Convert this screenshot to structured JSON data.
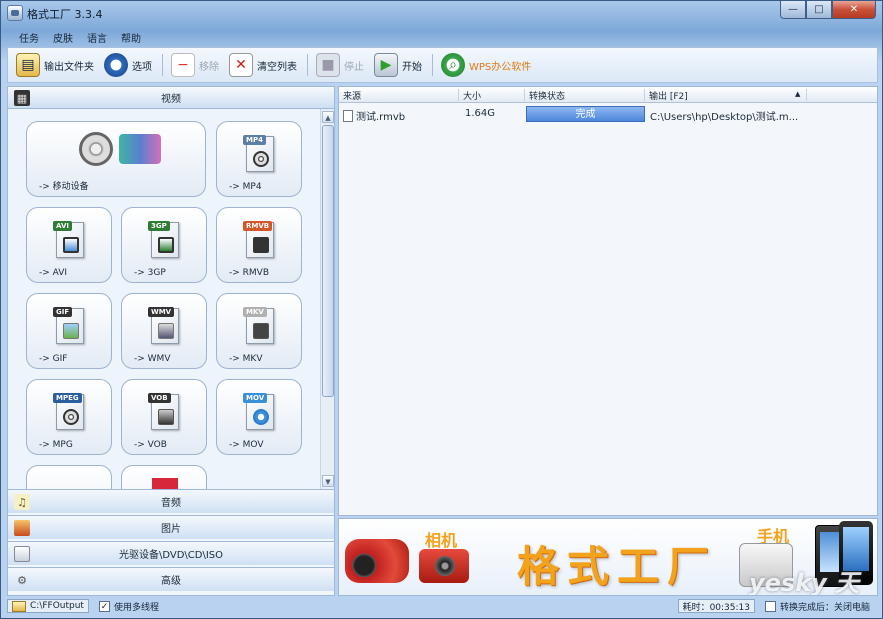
{
  "window": {
    "title": "格式工厂 3.3.4",
    "min": "—",
    "max": "□",
    "close": "✕"
  },
  "menu": [
    "任务",
    "皮肤",
    "语言",
    "帮助"
  ],
  "toolbar": {
    "output_folder": "输出文件夹",
    "options": "选项",
    "remove": "移除",
    "clear_list": "清空列表",
    "stop": "停止",
    "start": "开始",
    "wps": "WPS办公软件"
  },
  "left": {
    "video_header": "视频",
    "tiles": [
      {
        "label": "-> 移动设备",
        "tag": ""
      },
      {
        "label": "-> MP4",
        "tag": "MP4",
        "color": "#5b7fa6"
      },
      {
        "label": "-> AVI",
        "tag": "AVI",
        "color": "#2e7d32"
      },
      {
        "label": "-> 3GP",
        "tag": "3GP",
        "color": "#2e7d32"
      },
      {
        "label": "-> RMVB",
        "tag": "RMVB",
        "color": "#d4572a"
      },
      {
        "label": "-> GIF",
        "tag": "GIF",
        "color": "#333333"
      },
      {
        "label": "-> WMV",
        "tag": "WMV",
        "color": "#333333"
      },
      {
        "label": "-> MKV",
        "tag": "MKV",
        "color": "#b0b0b0"
      },
      {
        "label": "-> MPG",
        "tag": "MPEG",
        "color": "#2b5e9c"
      },
      {
        "label": "-> VOB",
        "tag": "VOB",
        "color": "#333333"
      },
      {
        "label": "-> MOV",
        "tag": "MOV",
        "color": "#3a8fd8"
      }
    ],
    "audio": "音频",
    "image": "图片",
    "optical": "光驱设备\\DVD\\CD\\ISO",
    "advanced": "高级"
  },
  "table": {
    "headers": [
      "来源",
      "大小",
      "转换状态",
      "输出 [F2]"
    ],
    "rows": [
      {
        "source": "测试.rmvb",
        "size": "1.64G",
        "status": "完成",
        "output": "C:\\Users\\hp\\Desktop\\测试.m..."
      }
    ]
  },
  "banner": {
    "title": "格式工厂",
    "camera_label": "相机",
    "phone_label": "手机",
    "watermark": "yesky 天极网"
  },
  "status": {
    "folder": "C:\\FFOutput",
    "multithread": "使用多线程",
    "elapsed": "耗时：00:35:13",
    "after": "转换完成后：关闭电脑"
  }
}
